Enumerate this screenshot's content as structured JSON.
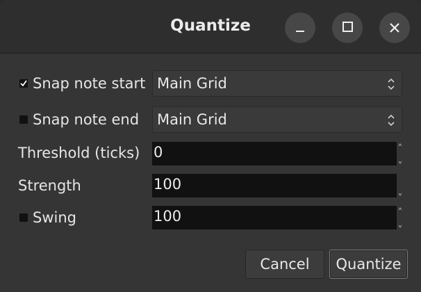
{
  "window": {
    "title": "Quantize",
    "controls": {
      "minimize_icon": "minimize-icon",
      "maximize_icon": "maximize-icon",
      "close_icon": "close-icon"
    }
  },
  "form": {
    "snap_start": {
      "label": "Snap note start",
      "checked": true,
      "value": "Main Grid"
    },
    "snap_end": {
      "label": "Snap note end",
      "checked": false,
      "value": "Main Grid"
    },
    "threshold": {
      "label": "Threshold (ticks)",
      "value": "0"
    },
    "strength": {
      "label": "Strength",
      "value": "100"
    },
    "swing": {
      "label": "Swing",
      "checked": false,
      "value": "100"
    }
  },
  "buttons": {
    "cancel": "Cancel",
    "quantize": "Quantize"
  }
}
